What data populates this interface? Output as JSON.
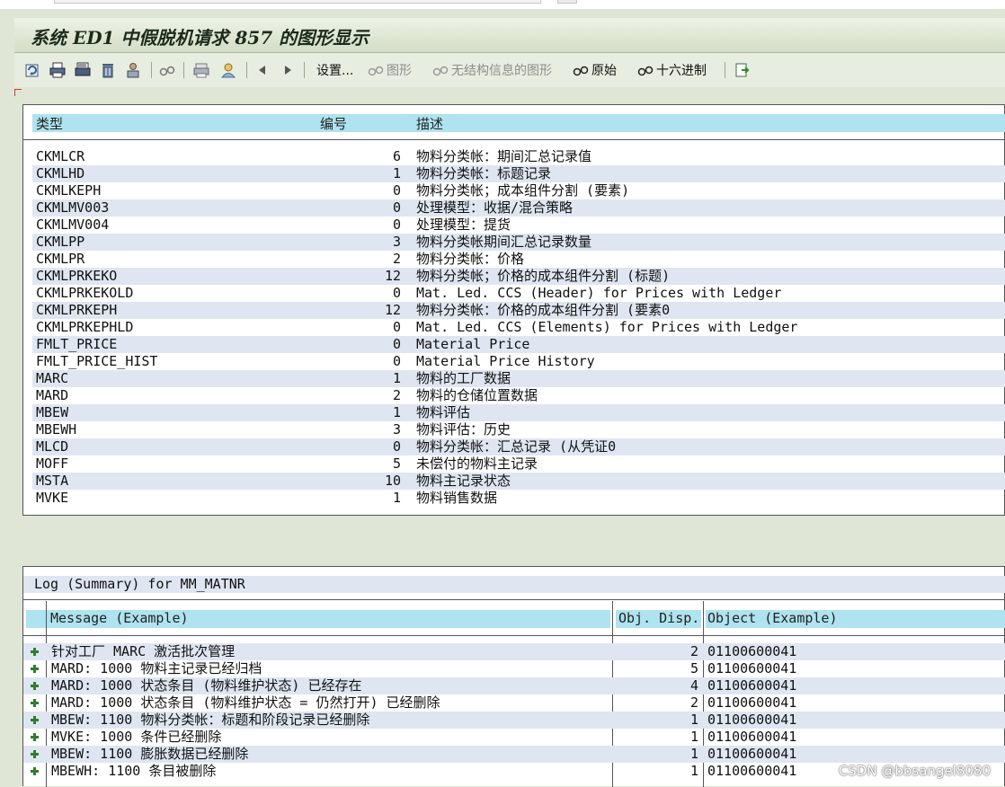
{
  "window": {
    "title": "系统 ED1 中假脱机请求 857 的图形显示"
  },
  "toolbar": {
    "settings": "设置...",
    "graphic": "图形",
    "unstructured": "无结构信息的图形",
    "raw": "原始",
    "hex": "十六进制"
  },
  "objects_table": {
    "headers": {
      "type": "类型",
      "number": "编号",
      "description": "描述"
    },
    "rows": [
      {
        "type": "CKMLCR",
        "num": "6",
        "desc": "物料分类帐：期间汇总记录值"
      },
      {
        "type": "CKMLHD",
        "num": "1",
        "desc": "物料分类帐：标题记录"
      },
      {
        "type": "CKMLKEPH",
        "num": "0",
        "desc": "物料分类帐；成本组件分割 (要素)"
      },
      {
        "type": "CKMLMV003",
        "num": "0",
        "desc": "处理模型：收据/混合策略"
      },
      {
        "type": "CKMLMV004",
        "num": "0",
        "desc": "处理模型：提货"
      },
      {
        "type": "CKMLPP",
        "num": "3",
        "desc": "物料分类帐期间汇总记录数量"
      },
      {
        "type": "CKMLPR",
        "num": "2",
        "desc": "物料分类帐：价格"
      },
      {
        "type": "CKMLPRKEKO",
        "num": "12",
        "desc": "物料分类帐；价格的成本组件分割 (标题)"
      },
      {
        "type": "CKMLPRKEKOLD",
        "num": "0",
        "desc": "Mat. Led. CCS (Header) for Prices with Ledger"
      },
      {
        "type": "CKMLPRKEPH",
        "num": "12",
        "desc": "物料分类帐：价格的成本组件分割 (要素0"
      },
      {
        "type": "CKMLPRKEPHLD",
        "num": "0",
        "desc": "Mat. Led. CCS (Elements) for Prices with Ledger"
      },
      {
        "type": "FMLT_PRICE",
        "num": "0",
        "desc": "Material Price"
      },
      {
        "type": "FMLT_PRICE_HIST",
        "num": "0",
        "desc": "Material Price History"
      },
      {
        "type": "MARC",
        "num": "1",
        "desc": "物料的工厂数据"
      },
      {
        "type": "MARD",
        "num": "2",
        "desc": "物料的仓储位置数据"
      },
      {
        "type": "MBEW",
        "num": "1",
        "desc": "物料评估"
      },
      {
        "type": "MBEWH",
        "num": "3",
        "desc": "物料评估：历史"
      },
      {
        "type": "MLCD",
        "num": "0",
        "desc": "物料分类帐：汇总记录 (从凭证0"
      },
      {
        "type": "MOFF",
        "num": "5",
        "desc": "未偿付的物料主记录"
      },
      {
        "type": "MSTA",
        "num": "10",
        "desc": "物料主记录状态"
      },
      {
        "type": "MVKE",
        "num": "1",
        "desc": "物料销售数据"
      }
    ]
  },
  "log_table": {
    "title": "Log (Summary) for MM_MATNR",
    "headers": {
      "message": "Message (Example)",
      "obj_disp": "Obj. Disp.",
      "object": "Object (Example)"
    },
    "rows": [
      {
        "message": "针对工厂 MARC 激活批次管理",
        "disp": "2",
        "object": "01100600041"
      },
      {
        "message": "MARD: 1000 物料主记录已经归档",
        "disp": "5",
        "object": "01100600041"
      },
      {
        "message": "MARD: 1000 状态条目 (物料维护状态) 已经存在",
        "disp": "4",
        "object": "01100600041"
      },
      {
        "message": "MARD: 1000 状态条目 (物料维护状态 = 仍然打开) 已经删除",
        "disp": "2",
        "object": "01100600041"
      },
      {
        "message": "MBEW: 1100 物料分类帐：标题和阶段记录已经删除",
        "disp": "1",
        "object": "01100600041"
      },
      {
        "message": "MVKE: 1000 条件已经删除",
        "disp": "1",
        "object": "01100600041"
      },
      {
        "message": "MBEW: 1100  膨胀数据已经删除",
        "disp": "1",
        "object": "01100600041"
      },
      {
        "message": "MBEWH: 1100 条目被删除",
        "disp": "1",
        "object": "01100600041"
      }
    ]
  },
  "watermark": "CSDN @bbsangel8080"
}
